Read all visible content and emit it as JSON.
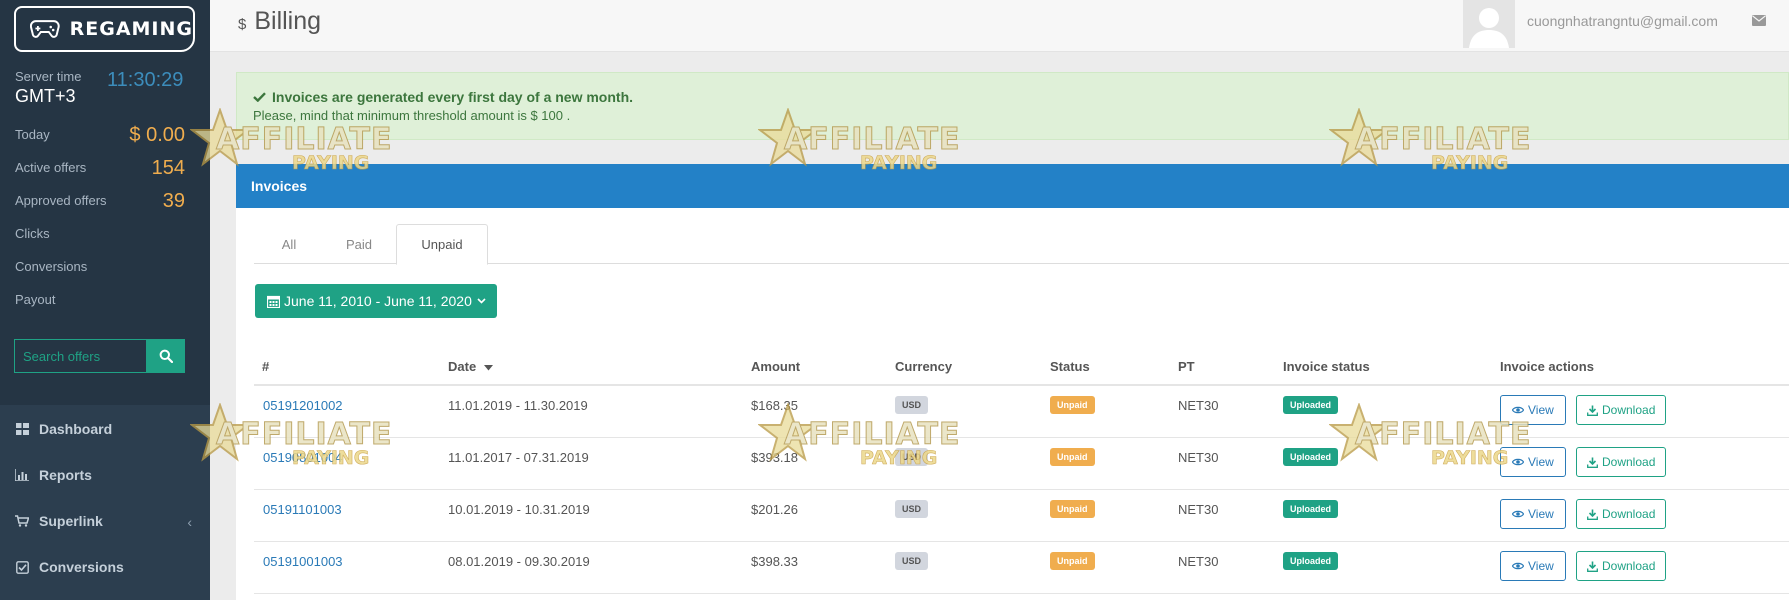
{
  "brand": {
    "name": "REGAMING"
  },
  "sidebar": {
    "server_time_label": "Server time",
    "server_time": "11:30:29",
    "timezone": "GMT+3",
    "stats": [
      {
        "label": "Today",
        "value": "$ 0.00"
      },
      {
        "label": "Active offers",
        "value": "154"
      },
      {
        "label": "Approved offers",
        "value": "39"
      },
      {
        "label": "Clicks",
        "value": ""
      },
      {
        "label": "Conversions",
        "value": ""
      },
      {
        "label": "Payout",
        "value": ""
      }
    ],
    "search": {
      "placeholder": "Search offers"
    },
    "nav": [
      {
        "label": "Dashboard",
        "icon": "dashboard-icon"
      },
      {
        "label": "Reports",
        "icon": "bar-chart-icon"
      },
      {
        "label": "Superlink",
        "icon": "cart-icon"
      },
      {
        "label": "Conversions",
        "icon": "check-square-icon"
      }
    ]
  },
  "header": {
    "title": "Billing",
    "title_icon": "$",
    "user_email": "cuongnhatrangntu@gmail.com"
  },
  "alert": {
    "title": "Invoices are generated every first day of a new month.",
    "message": "Please, mind that minimum threshold amount is $ 100 ."
  },
  "panel": {
    "title": "Invoices"
  },
  "tabs": [
    "All",
    "Paid",
    "Unpaid"
  ],
  "active_tab": "Unpaid",
  "date_range": "June 11, 2010 - June 11, 2020",
  "table": {
    "columns": [
      "#",
      "Date",
      "Amount",
      "Currency",
      "Status",
      "PT",
      "Invoice status",
      "Invoice actions"
    ],
    "view_label": "View",
    "download_label": "Download",
    "rows": [
      {
        "id": "05191201002",
        "date": "11.01.2019 - 11.30.2019",
        "amount": "$168.35",
        "currency": "USD",
        "status": "Unpaid",
        "pt": "NET30",
        "invoice_status": "Uploaded"
      },
      {
        "id": "05190801004",
        "date": "11.01.2017 - 07.31.2019",
        "amount": "$393.18",
        "currency": "USD",
        "status": "Unpaid",
        "pt": "NET30",
        "invoice_status": "Uploaded"
      },
      {
        "id": "05191101003",
        "date": "10.01.2019 - 10.31.2019",
        "amount": "$201.26",
        "currency": "USD",
        "status": "Unpaid",
        "pt": "NET30",
        "invoice_status": "Uploaded"
      },
      {
        "id": "05191001003",
        "date": "08.01.2019 - 09.30.2019",
        "amount": "$398.33",
        "currency": "USD",
        "status": "Unpaid",
        "pt": "NET30",
        "invoice_status": "Uploaded"
      }
    ]
  },
  "watermark": {
    "line1": "AFFILIATE",
    "line2": "PAYING"
  },
  "colors": {
    "sidebar": "#2c3e4f",
    "accent_green": "#1fa285",
    "panel_blue": "#2381c7",
    "warning": "#f0ad4e",
    "link": "#2a7ab7"
  }
}
